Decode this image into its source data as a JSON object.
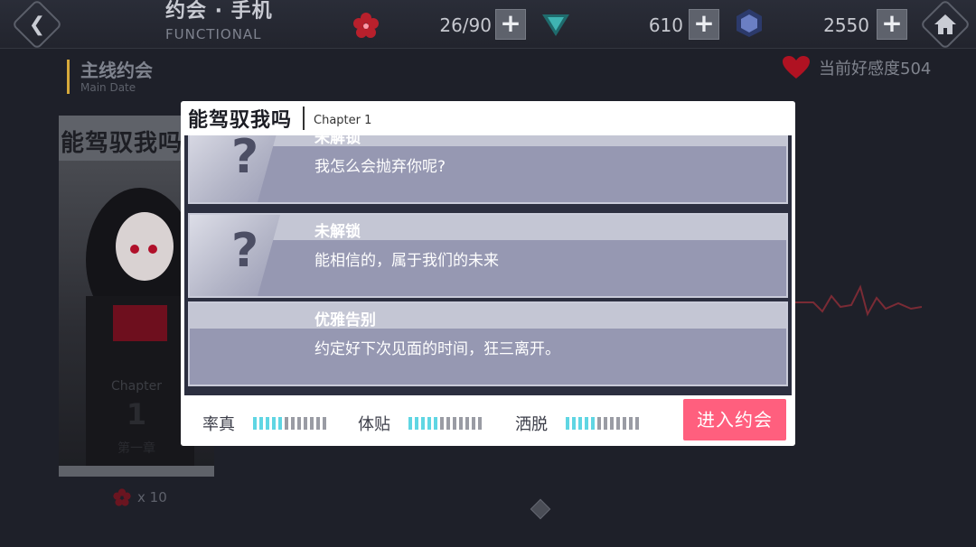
{
  "topbar": {
    "title_zh": "约会 · 手机",
    "title_en": "FUNCTIONAL",
    "resources": [
      {
        "icon": "sakura-icon",
        "value": "26/90"
      },
      {
        "icon": "crystal-icon",
        "value": "610"
      },
      {
        "icon": "cube-gem-icon",
        "value": "2550"
      }
    ],
    "plus": "+",
    "back_glyph": "❮"
  },
  "section": {
    "title_zh": "主线约会",
    "title_en": "Main Date"
  },
  "affection": {
    "label": "当前好感度504",
    "color": "#e01b2f"
  },
  "bg_card": {
    "title": "能驾驭我吗",
    "chapter_label": "Chapter",
    "chapter_num": "1",
    "chapter_zh": "第一章",
    "cost": "x 10"
  },
  "modal": {
    "title": "能驾驭我吗",
    "subtitle": "Chapter 1",
    "entries": [
      {
        "title": "未解锁",
        "desc": "我怎么会抛弃你呢?",
        "locked": true
      },
      {
        "title": "未解锁",
        "desc": "能相信的，属于我们的未来",
        "locked": true
      },
      {
        "title": "优雅告别",
        "desc": "约定好下次见面的时间，狂三离开。",
        "locked": false
      }
    ],
    "question_mark": "?",
    "stats": [
      {
        "label": "率真",
        "filled": 5,
        "total": 12
      },
      {
        "label": "体贴",
        "filled": 5,
        "total": 12
      },
      {
        "label": "洒脱",
        "filled": 5,
        "total": 12
      }
    ],
    "enter_button": "进入约会"
  },
  "colors": {
    "accent_pink": "#ff5f7e",
    "meter_on": "#5fd6e3",
    "gold": "#d6a93a"
  }
}
